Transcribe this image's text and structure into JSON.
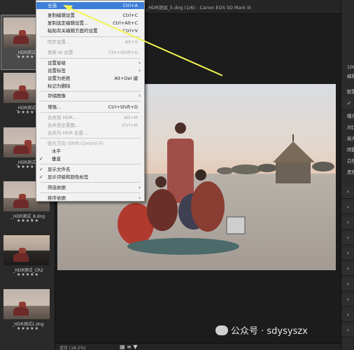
{
  "titlebar": {
    "title": "_HDR测试_5.dng (1/6) - Canon EOS 5D Mark III"
  },
  "filmstrip": {
    "thumbnails": [
      {
        "name": "_HDR测试_1",
        "stars": "★★★★★"
      },
      {
        "name": "_HDR测试_6",
        "stars": "★★★★★"
      },
      {
        "name": "_HDR测试_7",
        "stars": "★★★★★"
      },
      {
        "name": "_HDR测试_8.dng",
        "stars": "★★★★★"
      },
      {
        "name": "_HDR测试_CR2",
        "stars": "★★★★★"
      },
      {
        "name": "_HDR测试1.dng",
        "stars": "★★★★★"
      }
    ]
  },
  "menu": {
    "items": [
      {
        "label": "全选",
        "shortcut": "Ctrl+A",
        "state": "highlight"
      },
      {
        "label": "复制编辑设置",
        "shortcut": "Ctrl+C"
      },
      {
        "label": "复制选定编辑设置...",
        "shortcut": "Ctrl+Alt+C"
      },
      {
        "label": "粘贴有关编辑方面的设置",
        "shortcut": "Ctrl+V"
      },
      {
        "label": "同步设置...",
        "shortcut": "Alt+S",
        "state": "disabled"
      },
      {
        "label": "更新 AI 设置",
        "shortcut": "Ctrl+Shift+U",
        "state": "disabled"
      },
      {
        "label": "设置星级",
        "arrow": "›"
      },
      {
        "label": "设置标签",
        "arrow": "›"
      },
      {
        "label": "设置为拒绝",
        "shortcut": "Alt+Del 键"
      },
      {
        "label": "标记为删除",
        "shortcut": ""
      },
      {
        "label": "存储图像",
        "arrow": "›"
      },
      {
        "label": "增强...",
        "shortcut": "Ctrl+Shift+D"
      },
      {
        "label": "合并到 HDR...",
        "shortcut": "Alt+M",
        "state": "disabled"
      },
      {
        "label": "合并到全景图...",
        "shortcut": "Ctrl+M",
        "state": "disabled"
      },
      {
        "label": "合并为 HDR 全景...",
        "shortcut": "",
        "state": "disabled"
      },
      {
        "label": "胶片方向 (Shift-Control-F)",
        "shortcut": "",
        "state": "disabled"
      },
      {
        "label": "水平",
        "shortcut": ""
      },
      {
        "label": "垂直",
        "shortcut": "",
        "check": "✓"
      },
      {
        "label": "显示文件名",
        "shortcut": "",
        "check": "✓"
      },
      {
        "label": "显示评级和颜色标签",
        "shortcut": "",
        "check": "✓"
      },
      {
        "label": "筛选依据",
        "arrow": "›"
      },
      {
        "label": "排序依据",
        "arrow": "›"
      }
    ]
  },
  "rightpanel": {
    "labels": [
      "编辑",
      "配置",
      "曝光",
      "对比",
      "高光",
      "阴影",
      "白色",
      "黑色"
    ],
    "top_readout": "100"
  },
  "statusbar": {
    "zoom": "适合 (18.2%)"
  },
  "watermark": {
    "text": "公众号 · sdysyszx"
  },
  "colors": {
    "menu_highlight": "#3d7ed9",
    "annotation_arrow": "#f4f451"
  }
}
